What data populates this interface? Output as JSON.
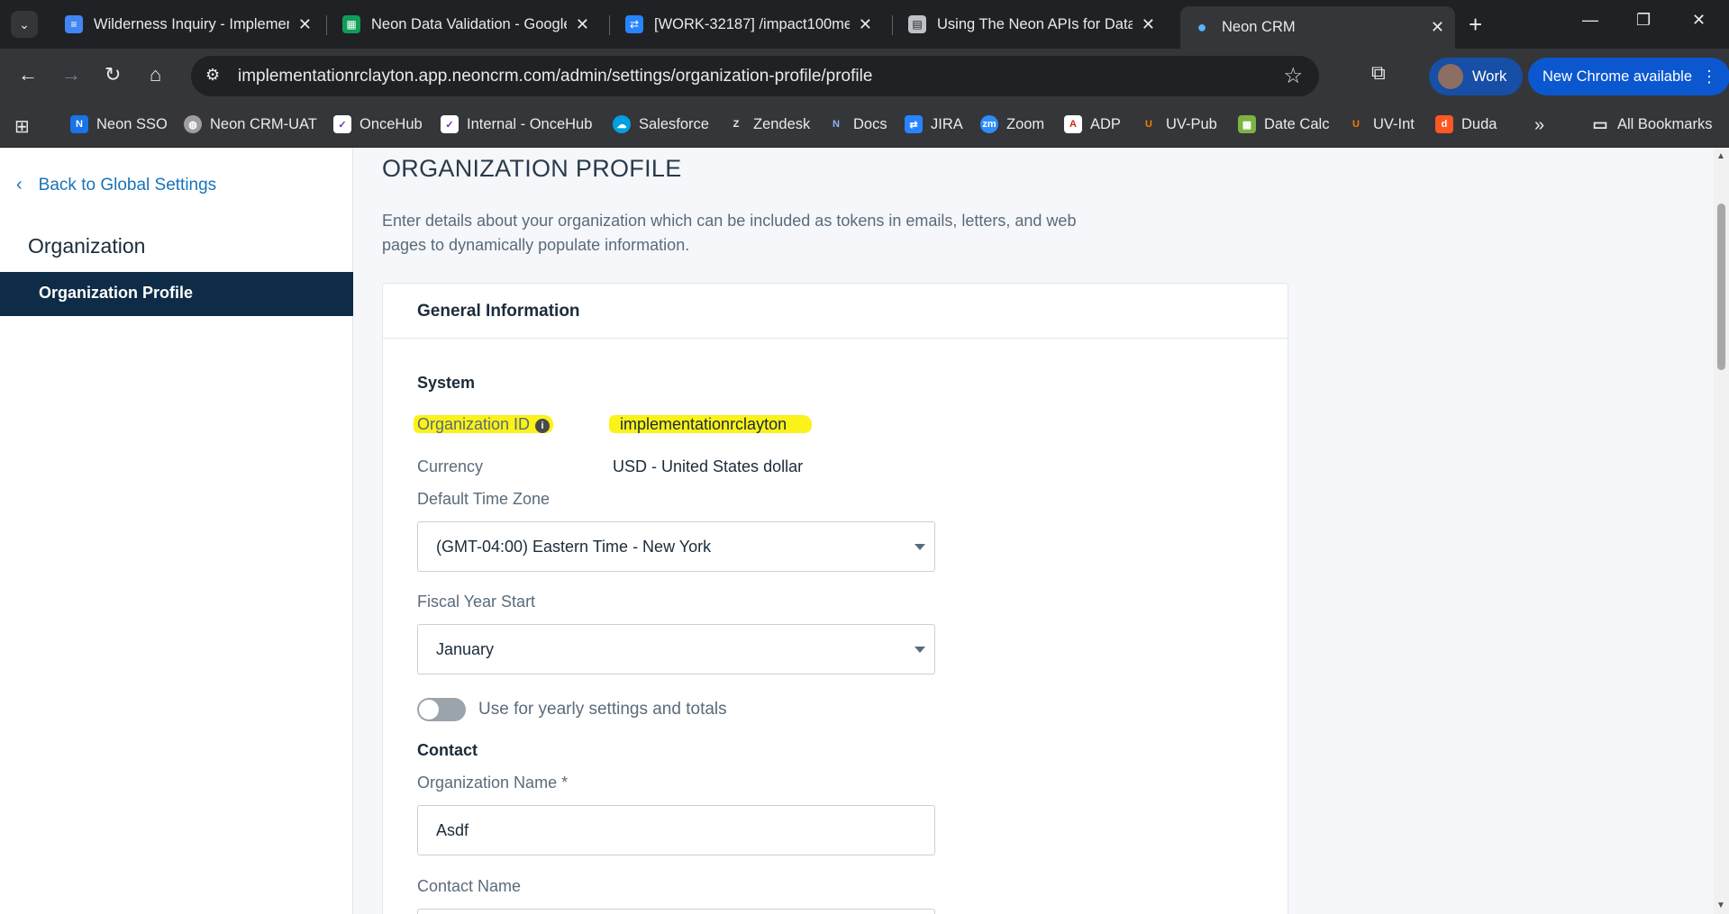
{
  "browser": {
    "tabs": [
      {
        "title": "Wilderness Inquiry - Implemen",
        "favicon": "docs-icon",
        "active": false
      },
      {
        "title": "Neon Data Validation - Google",
        "favicon": "sheets-icon",
        "active": false
      },
      {
        "title": "[WORK-32187] /impact100me",
        "favicon": "jira-icon",
        "active": false
      },
      {
        "title": "Using The Neon APIs for Data",
        "favicon": "doc-icon",
        "active": false
      },
      {
        "title": "Neon CRM",
        "favicon": "neon-icon",
        "active": true
      }
    ],
    "url": "implementationrclayton.app.neoncrm.com/admin/settings/organization-profile/profile",
    "profile_label": "Work",
    "update_label": "New Chrome available",
    "bookmarks": [
      {
        "label": "Neon SSO",
        "color": "#1a73e8"
      },
      {
        "label": "Neon CRM-UAT",
        "color": "#9e9e9e"
      },
      {
        "label": "OnceHub",
        "color": "#ffffff"
      },
      {
        "label": "Internal - OnceHub",
        "color": "#ffffff"
      },
      {
        "label": "Salesforce",
        "color": "#00a1e0"
      },
      {
        "label": "Zendesk",
        "color": "#03363d"
      },
      {
        "label": "Docs",
        "color": "#1a73e8"
      },
      {
        "label": "JIRA",
        "color": "#2684ff"
      },
      {
        "label": "Zoom",
        "color": "#2d8cff"
      },
      {
        "label": "ADP",
        "color": "#d0271d"
      },
      {
        "label": "UV-Pub",
        "color": "#f57c00"
      },
      {
        "label": "Date Calc",
        "color": "#7cb342"
      },
      {
        "label": "UV-Int",
        "color": "#f57c00"
      },
      {
        "label": "Duda",
        "color": "#ff5722"
      }
    ],
    "all_bookmarks_label": "All Bookmarks"
  },
  "sidebar": {
    "back_label": "Back to Global Settings",
    "section_title": "Organization",
    "items": [
      {
        "label": "Organization Profile",
        "active": true
      }
    ]
  },
  "main": {
    "title": "ORGANIZATION PROFILE",
    "description": "Enter details about your organization which can be included as tokens in emails, letters, and web pages to dynamically populate information.",
    "card_title": "General Information",
    "system": {
      "heading": "System",
      "org_id_label": "Organization ID",
      "org_id_value": "implementationrclayton",
      "currency_label": "Currency",
      "currency_value": "USD - United States dollar",
      "timezone_label": "Default Time Zone",
      "timezone_value": "(GMT-04:00) Eastern Time - New York",
      "fiscal_label": "Fiscal Year Start",
      "fiscal_value": "January",
      "toggle_label": "Use for yearly settings and totals",
      "toggle_on": false
    },
    "contact": {
      "heading": "Contact",
      "org_name_label": "Organization Name *",
      "org_name_value": "Asdf",
      "contact_name_label": "Contact Name"
    }
  },
  "colors": {
    "accent": "#1a73b8",
    "nav_active": "#0e2c47",
    "highlight": "#fbf21a"
  }
}
